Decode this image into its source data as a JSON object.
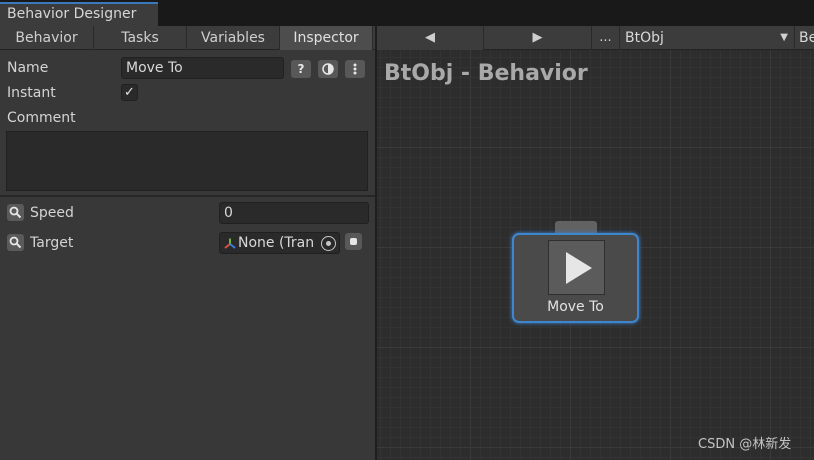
{
  "window": {
    "tab_title": "Behavior Designer"
  },
  "toolbar": {
    "tabs": [
      {
        "label": "Behavior",
        "active": false
      },
      {
        "label": "Tasks",
        "active": false
      },
      {
        "label": "Variables",
        "active": false
      },
      {
        "label": "Inspector",
        "active": true
      }
    ],
    "prev_glyph": "◀",
    "next_glyph": "▶",
    "more_label": "...",
    "object_select": "BtObj",
    "behavior_select_clipped": "Be"
  },
  "inspector": {
    "name_label": "Name",
    "name_value": "Move To",
    "help_glyph": "?",
    "instant_label": "Instant",
    "instant_checked": true,
    "check_glyph": "✓",
    "comment_label": "Comment",
    "comment_value": "",
    "fields": [
      {
        "label": "Speed",
        "value": "0"
      },
      {
        "label": "Target",
        "value": "None (Tran"
      }
    ]
  },
  "graph": {
    "title": "BtObj - Behavior",
    "node": {
      "label": "Move To",
      "icon": "play-icon",
      "selected": true
    }
  },
  "watermark": "CSDN @林新发",
  "colors": {
    "selection": "#3f86cf",
    "panel": "#383838",
    "graph_bg": "#2d2d2d"
  }
}
